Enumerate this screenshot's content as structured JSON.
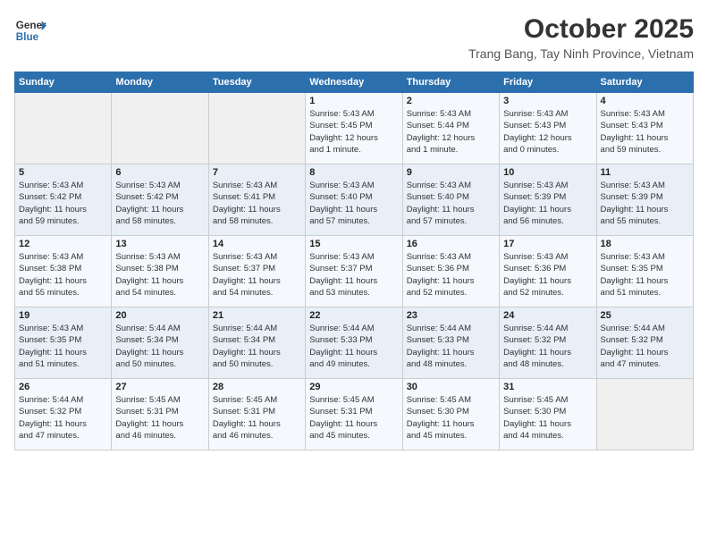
{
  "header": {
    "logo_line1": "General",
    "logo_line2": "Blue",
    "month": "October 2025",
    "location": "Trang Bang, Tay Ninh Province, Vietnam"
  },
  "weekdays": [
    "Sunday",
    "Monday",
    "Tuesday",
    "Wednesday",
    "Thursday",
    "Friday",
    "Saturday"
  ],
  "weeks": [
    [
      {
        "day": "",
        "info": ""
      },
      {
        "day": "",
        "info": ""
      },
      {
        "day": "",
        "info": ""
      },
      {
        "day": "1",
        "info": "Sunrise: 5:43 AM\nSunset: 5:45 PM\nDaylight: 12 hours\nand 1 minute."
      },
      {
        "day": "2",
        "info": "Sunrise: 5:43 AM\nSunset: 5:44 PM\nDaylight: 12 hours\nand 1 minute."
      },
      {
        "day": "3",
        "info": "Sunrise: 5:43 AM\nSunset: 5:43 PM\nDaylight: 12 hours\nand 0 minutes."
      },
      {
        "day": "4",
        "info": "Sunrise: 5:43 AM\nSunset: 5:43 PM\nDaylight: 11 hours\nand 59 minutes."
      }
    ],
    [
      {
        "day": "5",
        "info": "Sunrise: 5:43 AM\nSunset: 5:42 PM\nDaylight: 11 hours\nand 59 minutes."
      },
      {
        "day": "6",
        "info": "Sunrise: 5:43 AM\nSunset: 5:42 PM\nDaylight: 11 hours\nand 58 minutes."
      },
      {
        "day": "7",
        "info": "Sunrise: 5:43 AM\nSunset: 5:41 PM\nDaylight: 11 hours\nand 58 minutes."
      },
      {
        "day": "8",
        "info": "Sunrise: 5:43 AM\nSunset: 5:40 PM\nDaylight: 11 hours\nand 57 minutes."
      },
      {
        "day": "9",
        "info": "Sunrise: 5:43 AM\nSunset: 5:40 PM\nDaylight: 11 hours\nand 57 minutes."
      },
      {
        "day": "10",
        "info": "Sunrise: 5:43 AM\nSunset: 5:39 PM\nDaylight: 11 hours\nand 56 minutes."
      },
      {
        "day": "11",
        "info": "Sunrise: 5:43 AM\nSunset: 5:39 PM\nDaylight: 11 hours\nand 55 minutes."
      }
    ],
    [
      {
        "day": "12",
        "info": "Sunrise: 5:43 AM\nSunset: 5:38 PM\nDaylight: 11 hours\nand 55 minutes."
      },
      {
        "day": "13",
        "info": "Sunrise: 5:43 AM\nSunset: 5:38 PM\nDaylight: 11 hours\nand 54 minutes."
      },
      {
        "day": "14",
        "info": "Sunrise: 5:43 AM\nSunset: 5:37 PM\nDaylight: 11 hours\nand 54 minutes."
      },
      {
        "day": "15",
        "info": "Sunrise: 5:43 AM\nSunset: 5:37 PM\nDaylight: 11 hours\nand 53 minutes."
      },
      {
        "day": "16",
        "info": "Sunrise: 5:43 AM\nSunset: 5:36 PM\nDaylight: 11 hours\nand 52 minutes."
      },
      {
        "day": "17",
        "info": "Sunrise: 5:43 AM\nSunset: 5:36 PM\nDaylight: 11 hours\nand 52 minutes."
      },
      {
        "day": "18",
        "info": "Sunrise: 5:43 AM\nSunset: 5:35 PM\nDaylight: 11 hours\nand 51 minutes."
      }
    ],
    [
      {
        "day": "19",
        "info": "Sunrise: 5:43 AM\nSunset: 5:35 PM\nDaylight: 11 hours\nand 51 minutes."
      },
      {
        "day": "20",
        "info": "Sunrise: 5:44 AM\nSunset: 5:34 PM\nDaylight: 11 hours\nand 50 minutes."
      },
      {
        "day": "21",
        "info": "Sunrise: 5:44 AM\nSunset: 5:34 PM\nDaylight: 11 hours\nand 50 minutes."
      },
      {
        "day": "22",
        "info": "Sunrise: 5:44 AM\nSunset: 5:33 PM\nDaylight: 11 hours\nand 49 minutes."
      },
      {
        "day": "23",
        "info": "Sunrise: 5:44 AM\nSunset: 5:33 PM\nDaylight: 11 hours\nand 48 minutes."
      },
      {
        "day": "24",
        "info": "Sunrise: 5:44 AM\nSunset: 5:32 PM\nDaylight: 11 hours\nand 48 minutes."
      },
      {
        "day": "25",
        "info": "Sunrise: 5:44 AM\nSunset: 5:32 PM\nDaylight: 11 hours\nand 47 minutes."
      }
    ],
    [
      {
        "day": "26",
        "info": "Sunrise: 5:44 AM\nSunset: 5:32 PM\nDaylight: 11 hours\nand 47 minutes."
      },
      {
        "day": "27",
        "info": "Sunrise: 5:45 AM\nSunset: 5:31 PM\nDaylight: 11 hours\nand 46 minutes."
      },
      {
        "day": "28",
        "info": "Sunrise: 5:45 AM\nSunset: 5:31 PM\nDaylight: 11 hours\nand 46 minutes."
      },
      {
        "day": "29",
        "info": "Sunrise: 5:45 AM\nSunset: 5:31 PM\nDaylight: 11 hours\nand 45 minutes."
      },
      {
        "day": "30",
        "info": "Sunrise: 5:45 AM\nSunset: 5:30 PM\nDaylight: 11 hours\nand 45 minutes."
      },
      {
        "day": "31",
        "info": "Sunrise: 5:45 AM\nSunset: 5:30 PM\nDaylight: 11 hours\nand 44 minutes."
      },
      {
        "day": "",
        "info": ""
      }
    ]
  ]
}
